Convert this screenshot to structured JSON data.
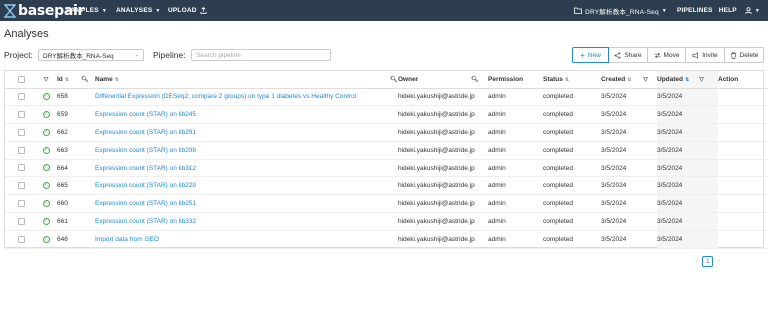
{
  "nav": {
    "brand": "basepair",
    "left_items": [
      {
        "label": "SAMPLES",
        "caret": true
      },
      {
        "label": "ANALYSES",
        "caret": true
      },
      {
        "label": "UPLOAD",
        "caret": false
      }
    ],
    "project_menu": "DRY解析教本_RNA-Seq",
    "pipelines": "PIPELINES",
    "help": "HELP"
  },
  "page": {
    "title": "Analyses",
    "project_label": "Project:",
    "project_value": "DRY解析教本_RNA-Seq",
    "pipeline_label": "Pipeline:",
    "pipeline_placeholder": "Search pipeline"
  },
  "actions": {
    "new": "New",
    "share": "Share",
    "move": "Move",
    "invite": "Invite",
    "delete": "Delete"
  },
  "table": {
    "columns": {
      "id": "Id",
      "name": "Name",
      "owner": "Owner",
      "permission": "Permission",
      "status": "Status",
      "created": "Created",
      "updated": "Updated",
      "action": "Action"
    },
    "rows": [
      {
        "id": "658",
        "name": "Differential Expression (DESeq2, compare 2 groups) on type 1 diabetes vs Healthy Control",
        "owner": "hideki.yakushiji@astride.jp",
        "permission": "admin",
        "status": "completed",
        "created": "3/5/2024",
        "updated": "3/5/2024"
      },
      {
        "id": "659",
        "name": "Expression count (STAR) on lib245",
        "owner": "hideki.yakushiji@astride.jp",
        "permission": "admin",
        "status": "completed",
        "created": "3/5/2024",
        "updated": "3/5/2024"
      },
      {
        "id": "662",
        "name": "Expression count (STAR) on lib291",
        "owner": "hideki.yakushiji@astride.jp",
        "permission": "admin",
        "status": "completed",
        "created": "3/5/2024",
        "updated": "3/5/2024"
      },
      {
        "id": "663",
        "name": "Expression count (STAR) on lib298",
        "owner": "hideki.yakushiji@astride.jp",
        "permission": "admin",
        "status": "completed",
        "created": "3/5/2024",
        "updated": "3/5/2024"
      },
      {
        "id": "664",
        "name": "Expression count (STAR) on lib312",
        "owner": "hideki.yakushiji@astride.jp",
        "permission": "admin",
        "status": "completed",
        "created": "3/5/2024",
        "updated": "3/5/2024"
      },
      {
        "id": "665",
        "name": "Expression count (STAR) on lib229",
        "owner": "hideki.yakushiji@astride.jp",
        "permission": "admin",
        "status": "completed",
        "created": "3/5/2024",
        "updated": "3/5/2024"
      },
      {
        "id": "660",
        "name": "Expression count (STAR) on lib251",
        "owner": "hideki.yakushiji@astride.jp",
        "permission": "admin",
        "status": "completed",
        "created": "3/5/2024",
        "updated": "3/5/2024"
      },
      {
        "id": "661",
        "name": "Expression count (STAR) on lib332",
        "owner": "hideki.yakushiji@astride.jp",
        "permission": "admin",
        "status": "completed",
        "created": "3/5/2024",
        "updated": "3/5/2024"
      },
      {
        "id": "646",
        "name": "Import data from GEO",
        "owner": "hideki.yakushiji@astride.jp",
        "permission": "admin",
        "status": "completed",
        "created": "3/5/2024",
        "updated": "3/5/2024"
      }
    ]
  },
  "pagination": {
    "current": "1"
  },
  "colors": {
    "navbar": "#2c3e50",
    "link": "#1e88e5",
    "status_ok": "#4caf50"
  }
}
